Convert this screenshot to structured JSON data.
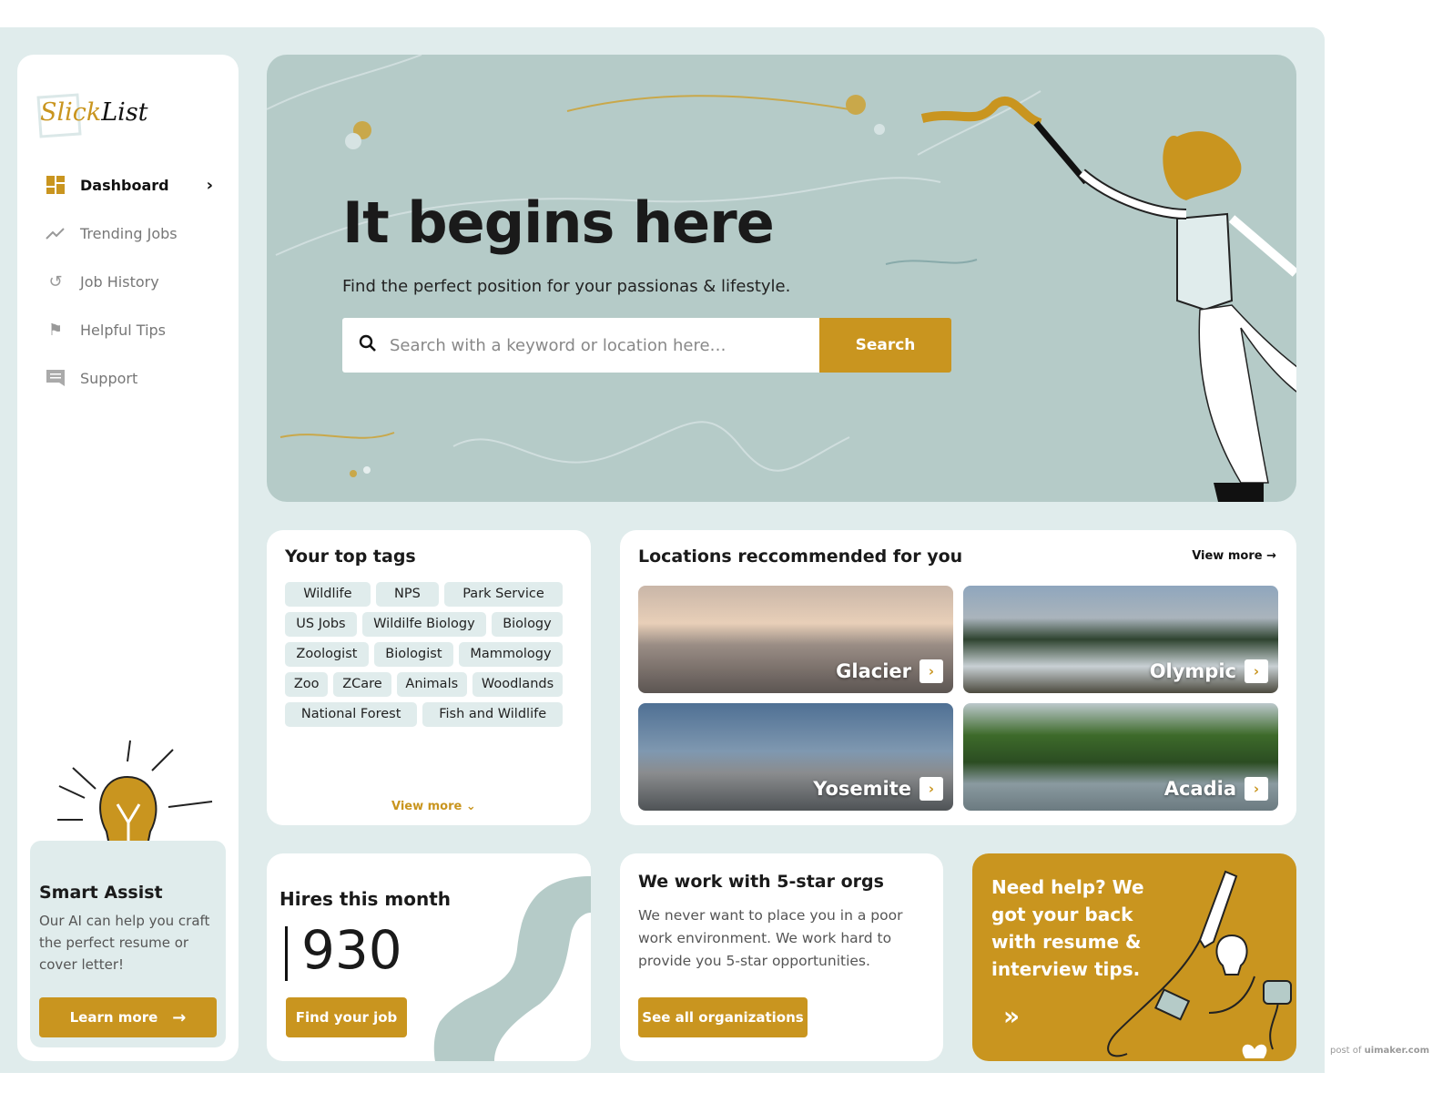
{
  "brand": {
    "part1": "Slick",
    "part2": "List"
  },
  "colors": {
    "accent": "#c9951f",
    "background": "#e0ecec",
    "hero": "#b5cbc8"
  },
  "sidebar": {
    "items": [
      {
        "label": "Dashboard",
        "icon": "dashboard-icon",
        "active": true
      },
      {
        "label": "Trending Jobs",
        "icon": "trending-icon"
      },
      {
        "label": "Job History",
        "icon": "history-icon"
      },
      {
        "label": "Helpful Tips",
        "icon": "flag-icon"
      },
      {
        "label": "Support",
        "icon": "chat-icon"
      }
    ],
    "assist": {
      "title": "Smart Assist",
      "text": "Our AI can help you craft the perfect resume or cover letter!",
      "button": "Learn more"
    }
  },
  "hero": {
    "title": "It begins here",
    "subtitle": "Find the perfect position for your passionas & lifestyle.",
    "search_placeholder": "Search with a keyword or location here…",
    "search_button": "Search"
  },
  "tags": {
    "title": "Your top tags",
    "items": [
      "Wildlife",
      "NPS",
      "Park Service",
      "US Jobs",
      "Wildilfe Biology",
      "Biology",
      "Zoologist",
      "Biologist",
      "Mammology",
      "Zoo",
      "ZCare",
      "Animals",
      "Woodlands",
      "National Forest",
      "Fish and Wildlife"
    ],
    "view_more": "View more"
  },
  "locations": {
    "title": "Locations reccommended for you",
    "view_more": "View more",
    "items": [
      "Glacier",
      "Olympic",
      "Yosemite",
      "Acadia"
    ]
  },
  "hires": {
    "title": "Hires this month",
    "value": "930",
    "button": "Find your job"
  },
  "orgs": {
    "title": "We work with 5-star orgs",
    "text": "We never want to place you in a poor work environment. We work hard to provide you 5-star opportunities.",
    "button": "See all organizations"
  },
  "help": {
    "text": "Need help? We got your back with resume & interview tips."
  },
  "watermark": {
    "prefix": "post of ",
    "site": "uimaker.com"
  }
}
